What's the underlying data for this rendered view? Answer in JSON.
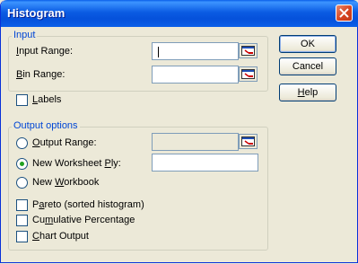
{
  "window": {
    "title": "Histogram"
  },
  "input_group": {
    "legend": "Input",
    "input_range": {
      "label_pre": "",
      "label_key": "I",
      "label_post": "nput Range:",
      "value": ""
    },
    "bin_range": {
      "label_pre": "",
      "label_key": "B",
      "label_post": "in Range:",
      "value": ""
    },
    "labels": {
      "label_pre": "",
      "label_key": "L",
      "label_post": "abels",
      "checked": false
    }
  },
  "output_group": {
    "legend": "Output options",
    "output_range": {
      "label_pre": "",
      "label_key": "O",
      "label_post": "utput Range:",
      "selected": false,
      "value": ""
    },
    "new_worksheet": {
      "label_pre": "New Worksheet ",
      "label_key": "P",
      "label_post": "ly:",
      "selected": true,
      "value": ""
    },
    "new_workbook": {
      "label_pre": "New ",
      "label_key": "W",
      "label_post": "orkbook",
      "selected": false
    },
    "pareto": {
      "label_pre": "P",
      "label_key": "a",
      "label_post": "reto (sorted histogram)",
      "checked": false
    },
    "cumulative": {
      "label_pre": "Cu",
      "label_key": "m",
      "label_post": "ulative Percentage",
      "checked": false
    },
    "chart_output": {
      "label_pre": "",
      "label_key": "C",
      "label_post": "hart Output",
      "checked": false
    }
  },
  "buttons": {
    "ok": "OK",
    "cancel": "Cancel",
    "help_key": "H",
    "help_post": "elp"
  },
  "icons": {
    "close": "close-icon",
    "ref_edit": "collapse-dialog-icon"
  }
}
